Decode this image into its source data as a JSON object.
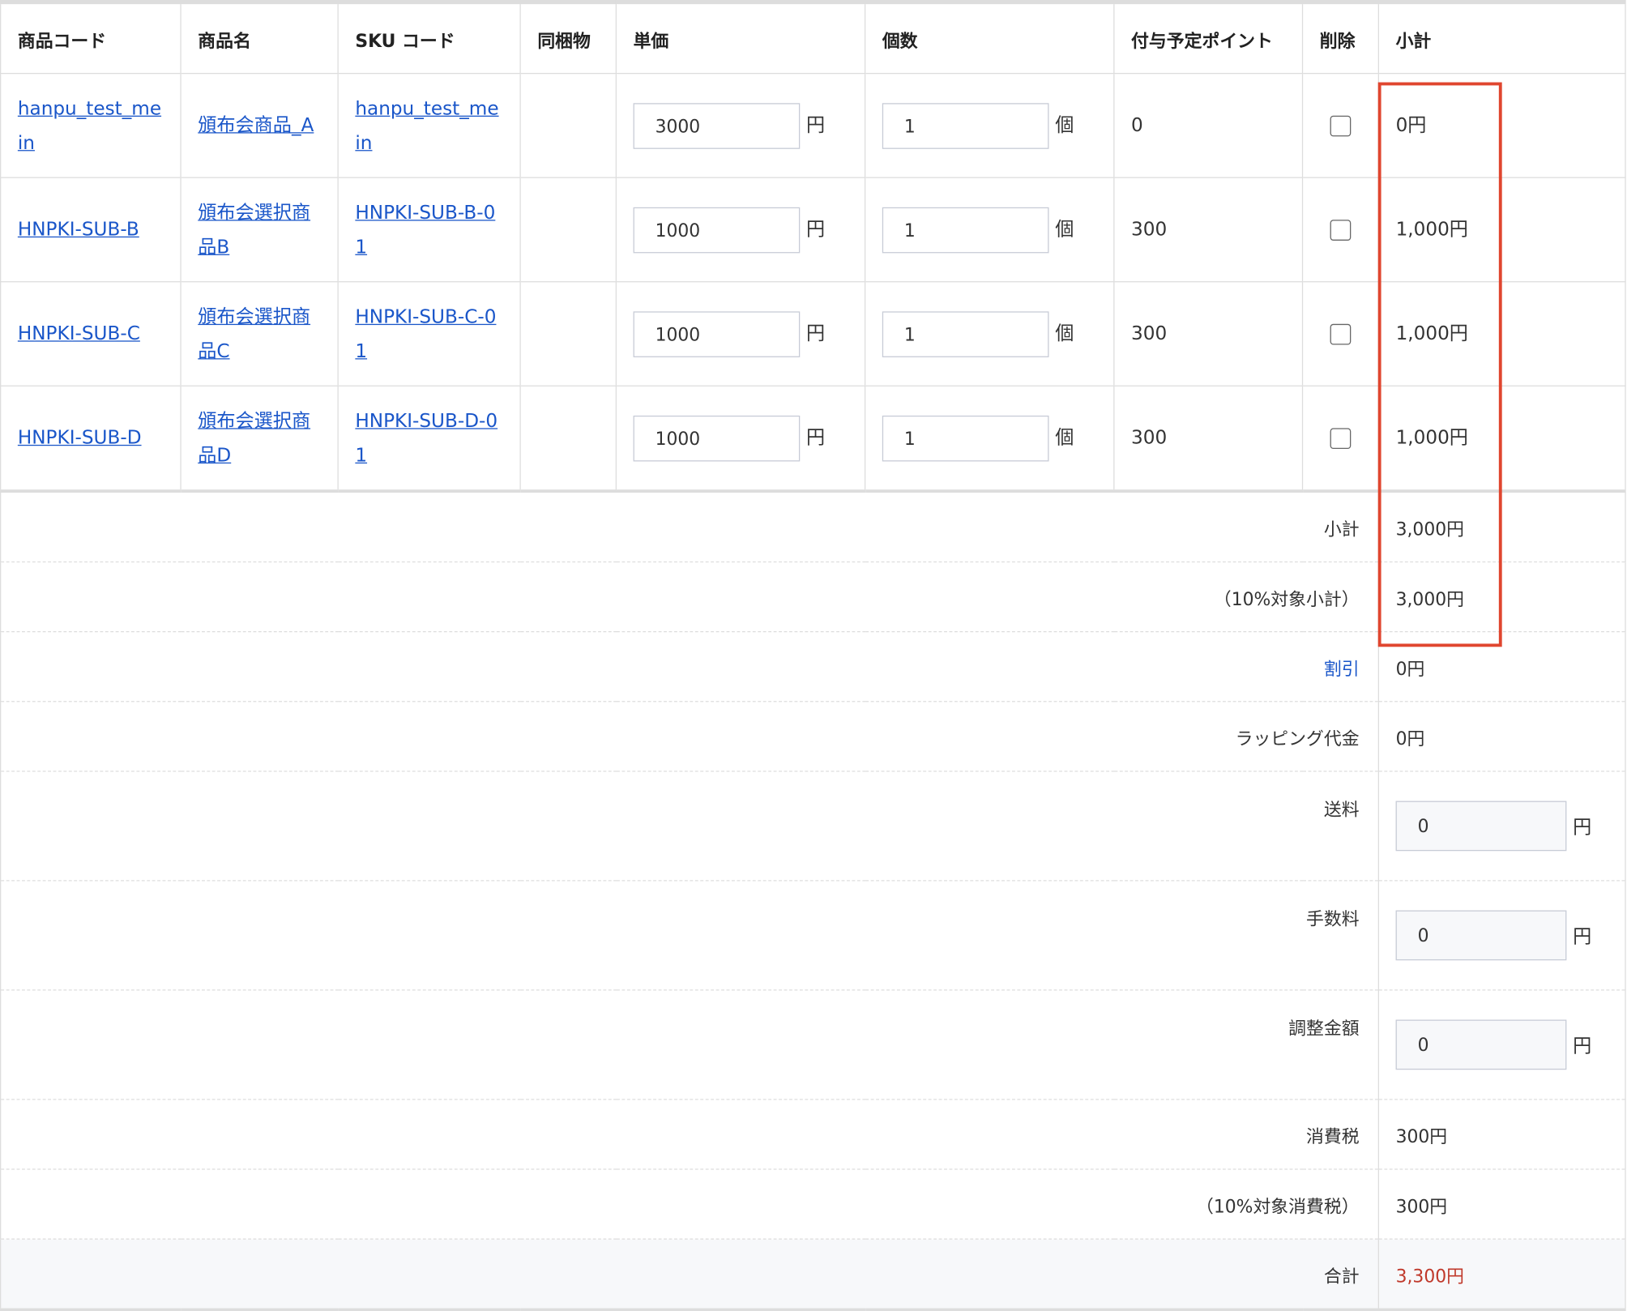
{
  "table": {
    "headers": {
      "code": "商品コード",
      "name": "商品名",
      "sku": "SKU コード",
      "bundle": "同梱物",
      "price": "単価",
      "qty": "個数",
      "points": "付与予定ポイント",
      "delete": "削除",
      "subtotal": "小計"
    },
    "rows": [
      {
        "code": "hanpu_test_mein",
        "name": "頒布会商品_A",
        "sku": "hanpu_test_mein",
        "bundle": "",
        "price": "3000",
        "price_unit": "円",
        "qty": "1",
        "qty_unit": "個",
        "points": "0",
        "delete_checked": false,
        "subtotal": "0円"
      },
      {
        "code": "HNPKI-SUB-B",
        "name": "頒布会選択商品B",
        "sku": "HNPKI-SUB-B-01",
        "bundle": "",
        "price": "1000",
        "price_unit": "円",
        "qty": "1",
        "qty_unit": "個",
        "points": "300",
        "delete_checked": false,
        "subtotal": "1,000円"
      },
      {
        "code": "HNPKI-SUB-C",
        "name": "頒布会選択商品C",
        "sku": "HNPKI-SUB-C-01",
        "bundle": "",
        "price": "1000",
        "price_unit": "円",
        "qty": "1",
        "qty_unit": "個",
        "points": "300",
        "delete_checked": false,
        "subtotal": "1,000円"
      },
      {
        "code": "HNPKI-SUB-D",
        "name": "頒布会選択商品D",
        "sku": "HNPKI-SUB-D-01",
        "bundle": "",
        "price": "1000",
        "price_unit": "円",
        "qty": "1",
        "qty_unit": "個",
        "points": "300",
        "delete_checked": false,
        "subtotal": "1,000円"
      }
    ]
  },
  "summary": {
    "subtotal": {
      "label": "小計",
      "value": "3,000円"
    },
    "subtotal_10": {
      "label": "（10%対象小計）",
      "value": "3,000円"
    },
    "discount": {
      "label": "割引",
      "value": "0円"
    },
    "wrapping": {
      "label": "ラッピング代金",
      "value": "0円"
    },
    "shipping": {
      "label": "送料",
      "value": "0",
      "unit": "円"
    },
    "fee": {
      "label": "手数料",
      "value": "0",
      "unit": "円"
    },
    "adjust": {
      "label": "調整金額",
      "value": "0",
      "unit": "円"
    },
    "tax": {
      "label": "消費税",
      "value": "300円"
    },
    "tax_10": {
      "label": "（10%対象消費税）",
      "value": "300円"
    },
    "total": {
      "label": "合計",
      "value": "3,300円"
    }
  },
  "colors": {
    "link": "#1a56c9",
    "highlight": "#e0462f",
    "total": "#c0392b",
    "border": "#dddddd",
    "footer_bg": "#f7f8fa"
  }
}
